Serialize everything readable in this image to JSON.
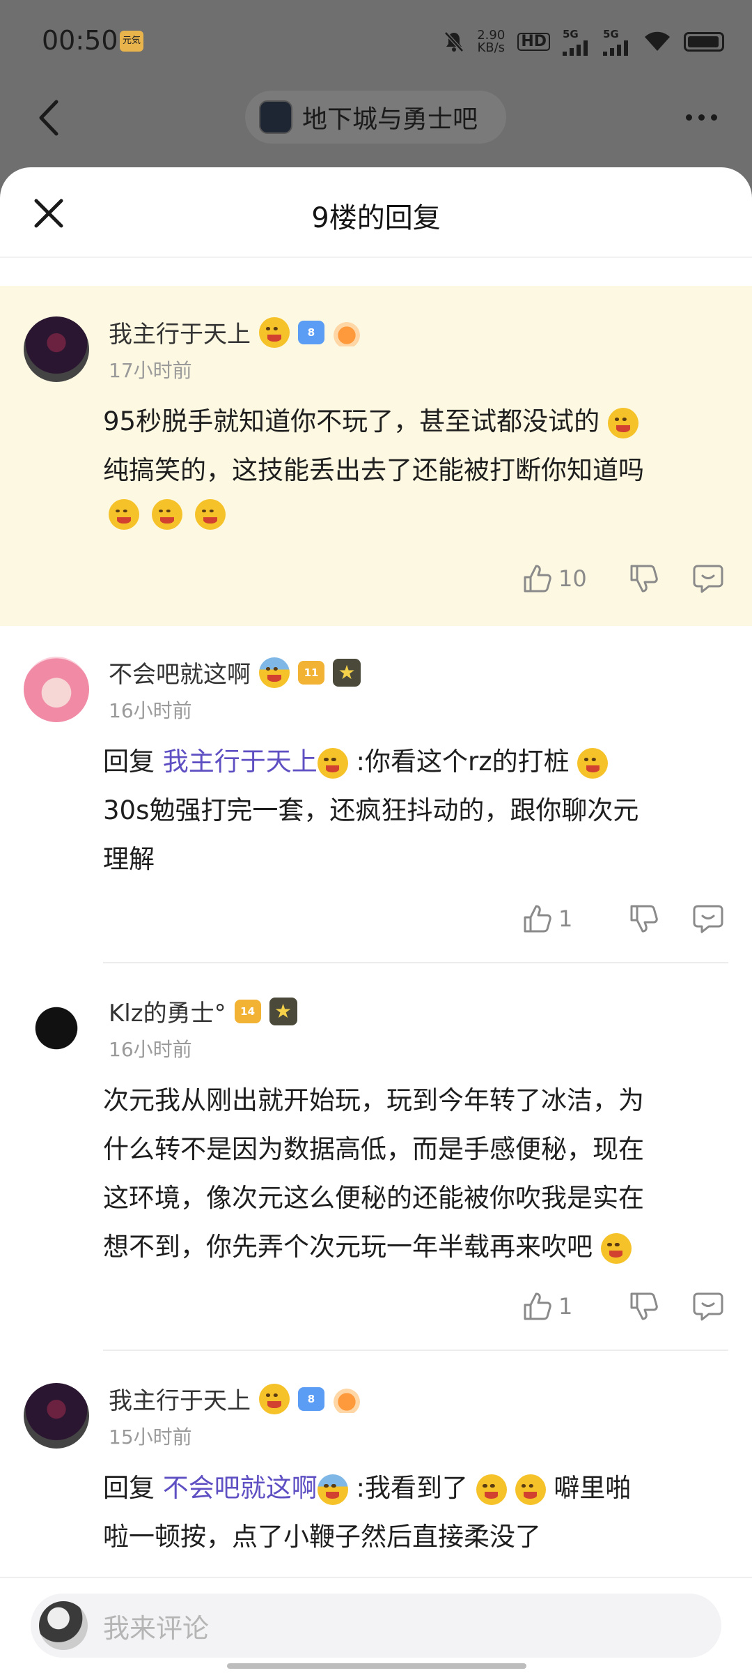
{
  "statusbar": {
    "time": "00:50",
    "time_badge": "元気",
    "speed_top": "2.90",
    "speed_bottom": "KB/s",
    "hd": "HD",
    "net1": "5G",
    "net2": "5G"
  },
  "topnav": {
    "forum_name": "地下城与勇士吧"
  },
  "sheet": {
    "title": "9楼的回复"
  },
  "comments": [
    {
      "user": "我主行于天上",
      "level": "8",
      "time": "17小时前",
      "text": "95秒脱手就知道你不玩了，甚至试都没试的",
      "text2": "纯搞笑的，这技能丢出去了还能被打断你知道吗",
      "likes": "10"
    },
    {
      "user": "不会吧就这啊",
      "level": "11",
      "time": "16小时前",
      "reply_prefix": "回复",
      "mention": "我主行于天上",
      "text": ":你看这个rz的打桩",
      "text2": "30s勉强打完一套，还疯狂抖动的，跟你聊次元",
      "text3": "理解",
      "likes": "1"
    },
    {
      "user": "Klz的勇士°",
      "level": "14",
      "time": "16小时前",
      "text": "次元我从刚出就开始玩，玩到今年转了冰洁，为",
      "text2": "什么转不是因为数据高低，而是手感便秘，现在",
      "text3": "这环境，像次元这么便秘的还能被你吹我是实在",
      "text4": "想不到，你先弄个次元玩一年半载再来吹吧",
      "likes": "1"
    },
    {
      "user": "我主行于天上",
      "level": "8",
      "time": "15小时前",
      "reply_prefix": "回复",
      "mention": "不会吧就这啊",
      "text": ":我看到了",
      "text_tail": "噼里啪",
      "text2": "啦一顿按，点了小鞭子然后直接柔没了"
    }
  ],
  "bottom_bar": {
    "placeholder": "我来评论"
  },
  "icons": {
    "back": "chevron-left-icon",
    "more": "more-icon",
    "close": "close-icon",
    "like": "thumb-up-icon",
    "dislike": "thumb-down-icon",
    "reply": "comment-icon"
  }
}
